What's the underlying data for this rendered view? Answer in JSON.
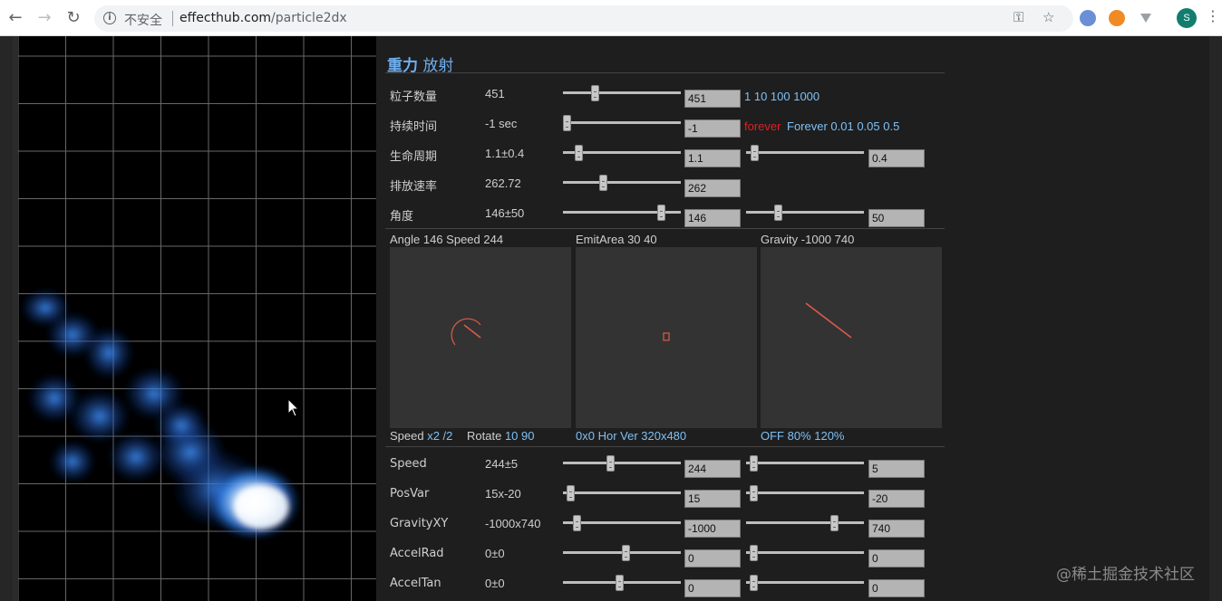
{
  "browser": {
    "security_label": "不安全",
    "url_host": "effecthub.com",
    "url_path": "/particle2dx",
    "profile_initial": "S",
    "back_icon": "arrow-left-icon",
    "forward_icon": "arrow-right-icon",
    "reload_icon": "reload-icon",
    "key_icon": "key-icon",
    "star_icon": "star-icon",
    "menu_icon": "more-vert-icon"
  },
  "panel": {
    "title_bold": "重力",
    "title_rest": " 放射",
    "rows_top": [
      {
        "label": "粒子数量",
        "value": "451",
        "input1": "451",
        "slider1": 0.26,
        "extra_links": "1 10 100 1000"
      },
      {
        "label": "持续时间",
        "value": "-1 sec",
        "input1": "-1",
        "slider1": 0.0,
        "extra_red": "forever",
        "extra_links": "Forever 0.01 0.05 0.5"
      },
      {
        "label": "生命周期",
        "value": "1.1±0.4",
        "input1": "1.1",
        "slider1": 0.11,
        "input2": "0.4",
        "slider2": 0.04
      },
      {
        "label": "排放速率",
        "value": "262.72",
        "input1": "262",
        "slider1": 0.33
      },
      {
        "label": "角度",
        "value": "146±50",
        "input1": "146",
        "slider1": 0.86,
        "input2": "50",
        "slider2": 0.26
      }
    ],
    "pads": [
      {
        "label": "Angle 146 Speed 244",
        "foot_plain": "Speed ",
        "foot_links": "x2 /2",
        "foot_plain2": "Rotate ",
        "foot_links2": "10 90"
      },
      {
        "label": "EmitArea 30 40",
        "foot_links": "0x0 Hor Ver 320x480"
      },
      {
        "label": "Gravity -1000 740",
        "foot_links": "OFF 80% 120%"
      }
    ],
    "rows_bottom": [
      {
        "label": "Speed",
        "value": "244±5",
        "input1": "244",
        "slider1": 0.4,
        "input2": "5",
        "slider2": 0.03
      },
      {
        "label": "PosVar",
        "value": "15x-20",
        "input1": "15",
        "slider1": 0.03,
        "input2": "-20",
        "slider2": 0.03
      },
      {
        "label": "GravityXY",
        "value": "-1000x740",
        "input1": "-1000",
        "slider1": 0.09,
        "input2": "740",
        "slider2": 0.77
      },
      {
        "label": "AccelRad",
        "value": "0±0",
        "input1": "0",
        "slider1": 0.54,
        "input2": "0",
        "slider2": 0.03
      },
      {
        "label": "AccelTan",
        "value": "0±0",
        "input1": "0",
        "slider1": 0.48,
        "input2": "0",
        "slider2": 0.03
      }
    ]
  },
  "watermark": "@稀土掘金技术社区",
  "colors": {
    "accent": "#6fb0f0",
    "particle": "#3a8cff",
    "vector": "#e05a4a"
  }
}
